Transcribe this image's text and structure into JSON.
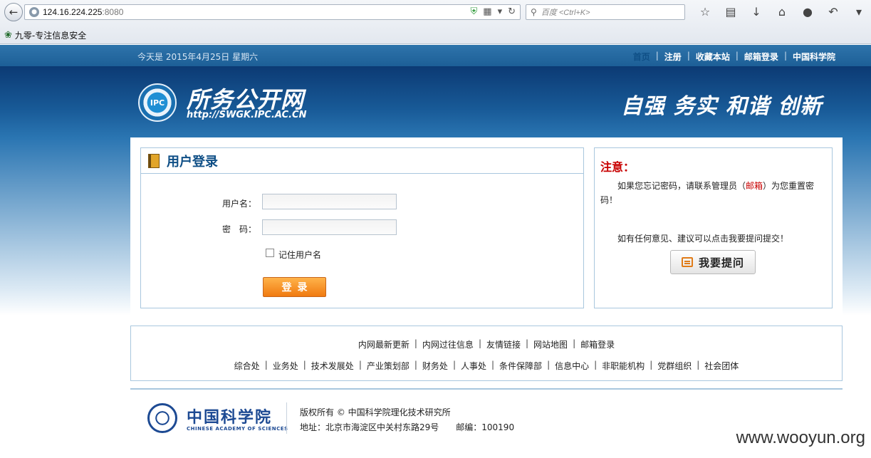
{
  "browser": {
    "url_host": "124.16.224.225",
    "url_port": ":8080",
    "search_placeholder": "百度 <Ctrl+K>",
    "bookmark_label": "九零-专注信息安全"
  },
  "header": {
    "date": "今天是  2015年4月25日 星期六",
    "links": [
      "首页",
      "注册",
      "收藏本站",
      "邮箱登录",
      "中国科学院"
    ],
    "logo_text": "IPC",
    "site_name": "所务公开网",
    "site_url": "http://SWGK.IPC.AC.CN",
    "slogan": "自强 务实 和谐 创新"
  },
  "login": {
    "title": "用户登录",
    "username_label": "用户名：",
    "password_label": "密　码：",
    "remember_label": "记住用户名",
    "submit_label": "登录"
  },
  "notice": {
    "title": "注意：",
    "text_before": "如果您忘记密码，请联系管理员（",
    "mail_link": "邮箱",
    "text_after": "）为您重置密码！",
    "suggest": "如有任何意见、建议可以点击我要提问提交！",
    "ask_label": "我要提问"
  },
  "links_row1": [
    "内网最新更新",
    "内网过往信息",
    "友情链接",
    "网站地图",
    "邮箱登录"
  ],
  "links_row2": [
    "综合处",
    "业务处",
    "技术发展处",
    "产业策划部",
    "财务处",
    "人事处",
    "条件保障部",
    "信息中心",
    "非职能机构",
    "党群组织",
    "社会团体"
  ],
  "footer": {
    "cas_name": "中国科学院",
    "cas_en": "CHINESE ACADEMY OF SCIENCES",
    "copyright": "版权所有 © 中国科学院理化技术研究所",
    "address": "地址：北京市海淀区中关村东路29号　　邮编：100190"
  },
  "watermark": "www.wooyun.org"
}
